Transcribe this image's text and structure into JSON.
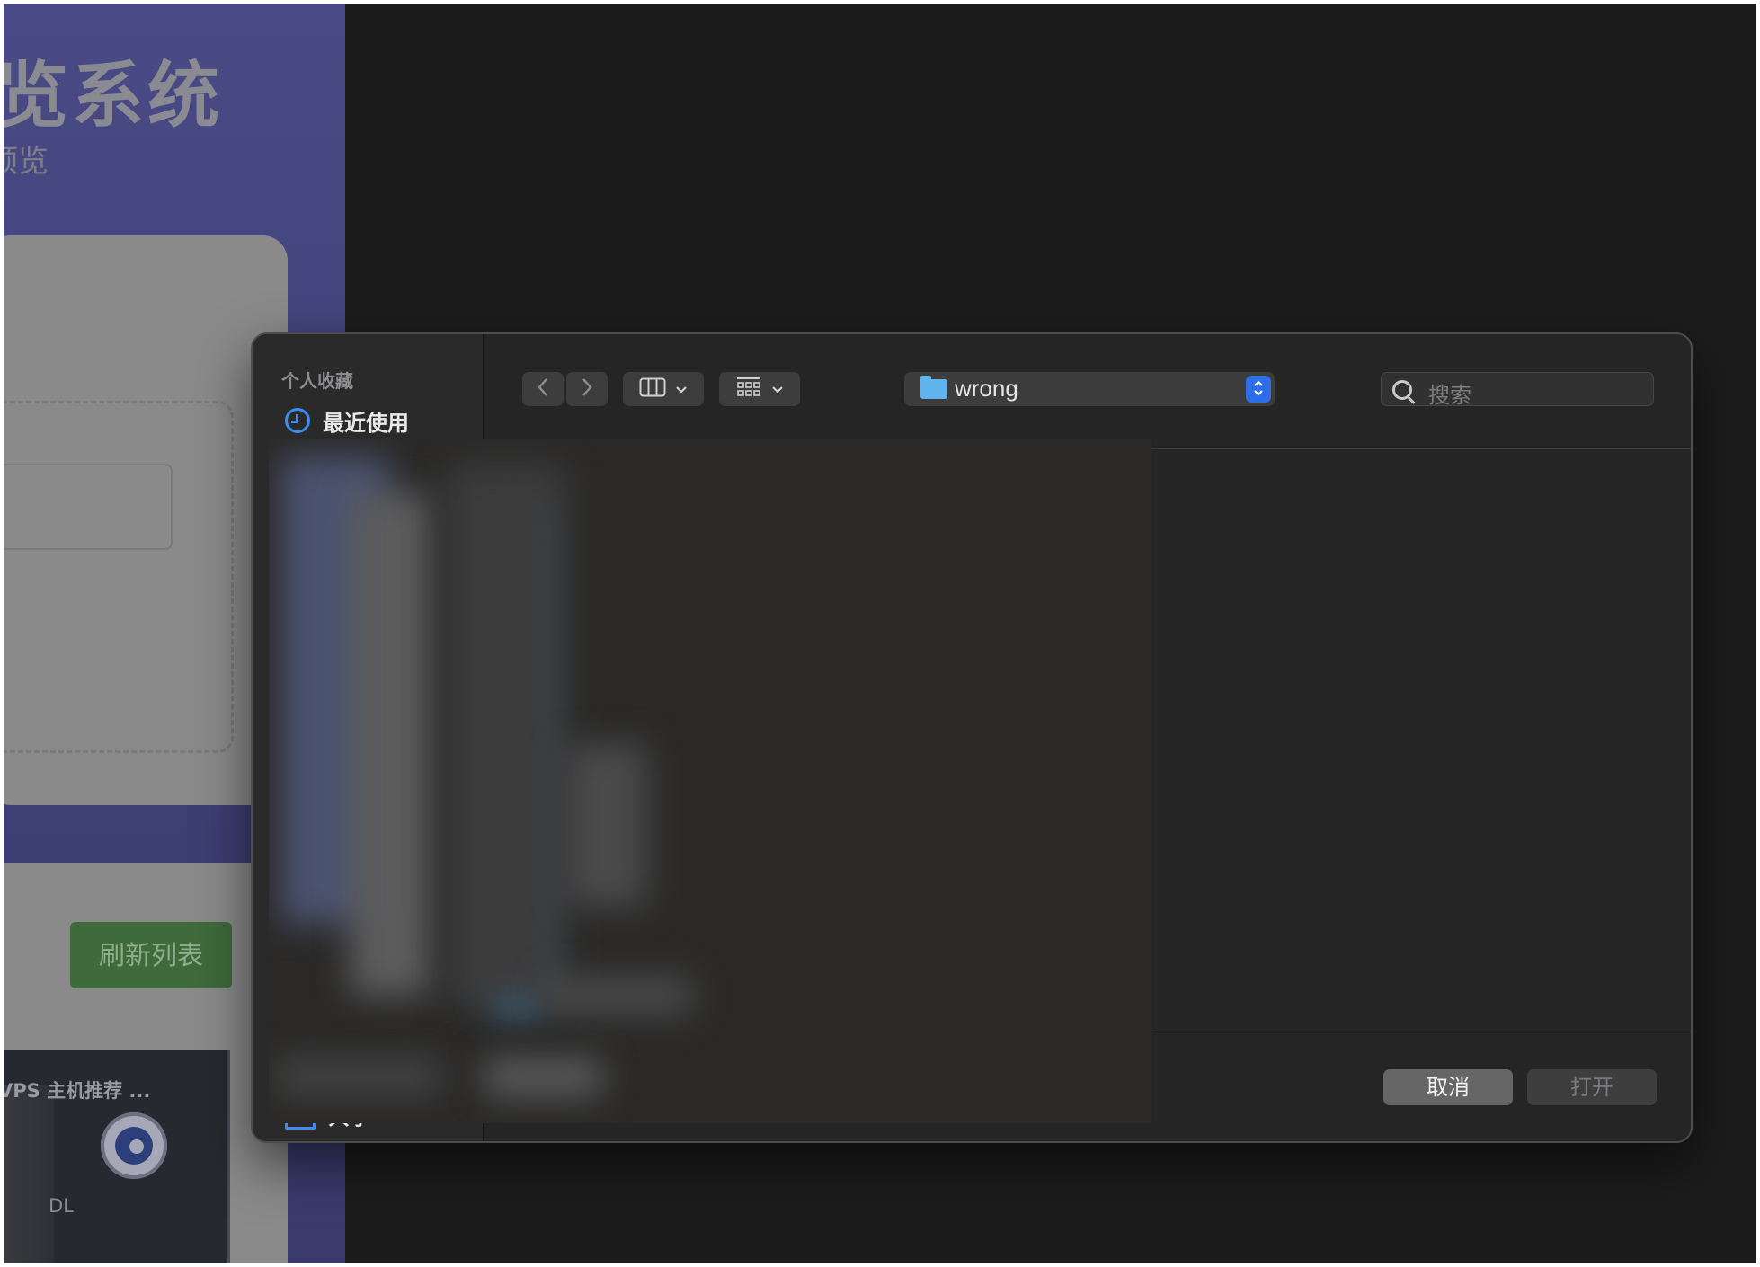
{
  "background_app": {
    "title_fragment": "览系统",
    "subtitle_fragment": "预览",
    "refresh_button": "刷新列表",
    "video_card": {
      "title_fragment": "VPS 主机推荐 ...",
      "side_text": "DL"
    }
  },
  "dialog": {
    "sidebar": {
      "heading": "个人收藏",
      "items": [
        {
          "label": "最近使用",
          "icon": "clock-icon"
        },
        {
          "label": "共享",
          "icon": "shared-folder-icon"
        }
      ]
    },
    "toolbar": {
      "back": "‹",
      "forward": "›",
      "view_columns": "▥",
      "view_grid": "▦",
      "dropdown": "⌄"
    },
    "location": {
      "folder_name": "wrong",
      "stepper": "⌃⌄"
    },
    "search": {
      "placeholder": "搜索"
    },
    "buttons": {
      "cancel": "取消",
      "open": "打开"
    }
  },
  "colors": {
    "accent": "#2d6ee6",
    "folder": "#5fb4ee",
    "sidebar_icon": "#3d8cf0"
  }
}
